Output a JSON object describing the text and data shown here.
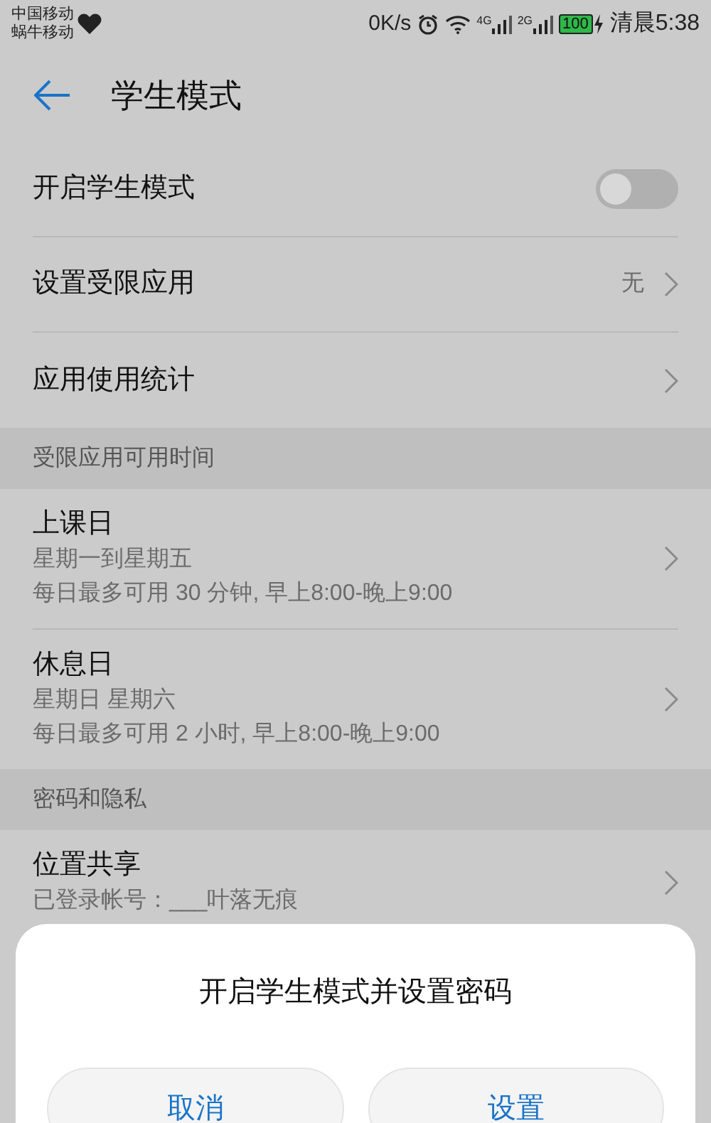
{
  "status_bar": {
    "carriers": [
      "中国移动",
      "蜗牛移动"
    ],
    "speed": "0K/s",
    "networks": [
      "4G",
      "2G"
    ],
    "battery": "100",
    "time": "清晨5:38"
  },
  "header": {
    "title": "学生模式"
  },
  "sections": [
    {
      "items": [
        {
          "kind": "toggle",
          "title": "开启学生模式",
          "on": false
        },
        {
          "kind": "value",
          "title": "设置受限应用",
          "value": "无"
        },
        {
          "kind": "nav",
          "title": "应用使用统计"
        }
      ]
    },
    {
      "heading": "受限应用可用时间",
      "items": [
        {
          "kind": "nav",
          "title": "上课日",
          "lines": [
            "星期一到星期五",
            "每日最多可用 30 分钟, 早上8:00-晚上9:00"
          ]
        },
        {
          "kind": "nav",
          "title": "休息日",
          "lines": [
            "星期日 星期六",
            "每日最多可用 2 小时, 早上8:00-晚上9:00"
          ]
        }
      ]
    },
    {
      "heading": "密码和隐私",
      "items": [
        {
          "kind": "nav",
          "title": "位置共享",
          "lines": [
            "已登录帐号：___叶落无痕"
          ]
        }
      ]
    }
  ],
  "dialog": {
    "title": "开启学生模式并设置密码",
    "buttons": [
      "取消",
      "设置"
    ]
  }
}
